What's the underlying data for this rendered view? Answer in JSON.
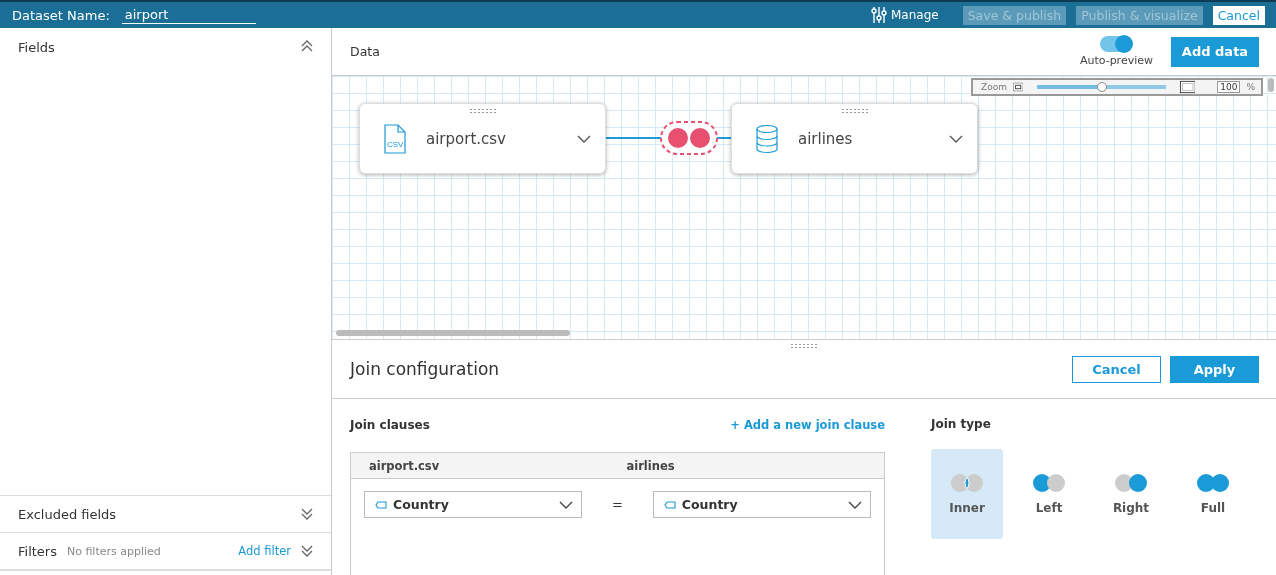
{
  "header": {
    "dataset_label": "Dataset Name:",
    "dataset_name": "airport",
    "manage": "Manage",
    "buttons": [
      {
        "label": "Save & publish",
        "disabled": true
      },
      {
        "label": "Publish & visualize",
        "disabled": true
      },
      {
        "label": "Cancel",
        "disabled": false
      }
    ]
  },
  "sidebar": {
    "fields_title": "Fields",
    "excluded_title": "Excluded fields",
    "filters_title": "Filters",
    "filters_status": "No filters applied",
    "add_filter": "Add filter"
  },
  "data": {
    "title": "Data",
    "auto_preview": {
      "label": "Auto-preview",
      "on": true
    },
    "add_data": "Add data",
    "zoom": {
      "label": "Zoom",
      "level": 0.5,
      "value": "100",
      "unit": "%"
    },
    "nodes": [
      {
        "name": "airport.csv",
        "kind": "file",
        "icon_text": "CSV"
      },
      {
        "name": "airlines",
        "kind": "database"
      }
    ]
  },
  "join": {
    "title": "Join configuration",
    "cancel": "Cancel",
    "apply": "Apply",
    "clauses_title": "Join clauses",
    "add_clause": "+ Add a new join clause",
    "columns": [
      "airport.csv",
      "airlines"
    ],
    "clauses": [
      {
        "left": "Country",
        "operator": "=",
        "right": "Country"
      }
    ],
    "type_title": "Join type",
    "types": [
      {
        "label": "Inner",
        "kind": "inner",
        "selected": true
      },
      {
        "label": "Left",
        "kind": "left",
        "selected": false
      },
      {
        "label": "Right",
        "kind": "right",
        "selected": false
      },
      {
        "label": "Full",
        "kind": "full",
        "selected": false
      }
    ]
  }
}
